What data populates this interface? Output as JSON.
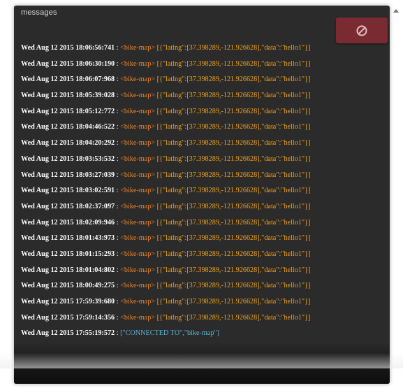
{
  "panel": {
    "title": "messages",
    "clear_button_icon": "block-icon"
  },
  "messages": [
    {
      "timestamp": "Wed Aug 12 2015 18:06:56:741",
      "separator": " : ",
      "channel": "<bike-map>",
      "payload": "[{\"latlng\":[37.398289,-121.926628],\"data\":\"hello1\"}]",
      "kind": "data"
    },
    {
      "timestamp": "Wed Aug 12 2015 18:06:30:190",
      "separator": " : ",
      "channel": "<bike-map>",
      "payload": "[{\"latlng\":[37.398289,-121.926628],\"data\":\"hello1\"}]",
      "kind": "data"
    },
    {
      "timestamp": "Wed Aug 12 2015 18:06:07:968",
      "separator": " : ",
      "channel": "<bike-map>",
      "payload": "[{\"latlng\":[37.398289,-121.926628],\"data\":\"hello1\"}]",
      "kind": "data"
    },
    {
      "timestamp": "Wed Aug 12 2015 18:05:39:028",
      "separator": " : ",
      "channel": "<bike-map>",
      "payload": "[{\"latlng\":[37.398289,-121.926628],\"data\":\"hello1\"}]",
      "kind": "data"
    },
    {
      "timestamp": "Wed Aug 12 2015 18:05:12:772",
      "separator": " : ",
      "channel": "<bike-map>",
      "payload": "[{\"latlng\":[37.398289,-121.926628],\"data\":\"hello1\"}]",
      "kind": "data"
    },
    {
      "timestamp": "Wed Aug 12 2015 18:04:46:522",
      "separator": " : ",
      "channel": "<bike-map>",
      "payload": "[{\"latlng\":[37.398289,-121.926628],\"data\":\"hello1\"}]",
      "kind": "data"
    },
    {
      "timestamp": "Wed Aug 12 2015 18:04:20:292",
      "separator": " : ",
      "channel": "<bike-map>",
      "payload": "[{\"latlng\":[37.398289,-121.926628],\"data\":\"hello1\"}]",
      "kind": "data"
    },
    {
      "timestamp": "Wed Aug 12 2015 18:03:53:532",
      "separator": " : ",
      "channel": "<bike-map>",
      "payload": "[{\"latlng\":[37.398289,-121.926628],\"data\":\"hello1\"}]",
      "kind": "data"
    },
    {
      "timestamp": "Wed Aug 12 2015 18:03:27:039",
      "separator": " : ",
      "channel": "<bike-map>",
      "payload": "[{\"latlng\":[37.398289,-121.926628],\"data\":\"hello1\"}]",
      "kind": "data"
    },
    {
      "timestamp": "Wed Aug 12 2015 18:03:02:591",
      "separator": " : ",
      "channel": "<bike-map>",
      "payload": "[{\"latlng\":[37.398289,-121.926628],\"data\":\"hello1\"}]",
      "kind": "data"
    },
    {
      "timestamp": "Wed Aug 12 2015 18:02:37:097",
      "separator": " : ",
      "channel": "<bike-map>",
      "payload": "[{\"latlng\":[37.398289,-121.926628],\"data\":\"hello1\"}]",
      "kind": "data"
    },
    {
      "timestamp": "Wed Aug 12 2015 18:02:09:946",
      "separator": " : ",
      "channel": "<bike-map>",
      "payload": "[{\"latlng\":[37.398289,-121.926628],\"data\":\"hello1\"}]",
      "kind": "data"
    },
    {
      "timestamp": "Wed Aug 12 2015 18:01:43:973",
      "separator": " : ",
      "channel": "<bike-map>",
      "payload": "[{\"latlng\":[37.398289,-121.926628],\"data\":\"hello1\"}]",
      "kind": "data"
    },
    {
      "timestamp": "Wed Aug 12 2015 18:01:15:293",
      "separator": " : ",
      "channel": "<bike-map>",
      "payload": "[{\"latlng\":[37.398289,-121.926628],\"data\":\"hello1\"}]",
      "kind": "data"
    },
    {
      "timestamp": "Wed Aug 12 2015 18:01:04:802",
      "separator": " : ",
      "channel": "<bike-map>",
      "payload": "[{\"latlng\":[37.398289,-121.926628],\"data\":\"hello1\"}]",
      "kind": "data"
    },
    {
      "timestamp": "Wed Aug 12 2015 18:00:49:275",
      "separator": " : ",
      "channel": "<bike-map>",
      "payload": "[{\"latlng\":[37.398289,-121.926628],\"data\":\"hello1\"}]",
      "kind": "data"
    },
    {
      "timestamp": "Wed Aug 12 2015 17:59:39:680",
      "separator": " : ",
      "channel": "<bike-map>",
      "payload": "[{\"latlng\":[37.398289,-121.926628],\"data\":\"hello1\"}]",
      "kind": "data"
    },
    {
      "timestamp": "Wed Aug 12 2015 17:59:14:356",
      "separator": " : ",
      "channel": "<bike-map>",
      "payload": "[{\"latlng\":[37.398289,-121.926628],\"data\":\"hello1\"}]",
      "kind": "data"
    },
    {
      "timestamp": "Wed Aug 12 2015 17:55:19:572",
      "separator": " : ",
      "channel": "",
      "payload": "[\"CONNECTED TO\",\"bike-map\"]",
      "kind": "info"
    }
  ],
  "colors": {
    "panel_bg": "#2b2b2b",
    "clear_button_bg": "#7a2a31",
    "timestamp": "#ffffff",
    "channel": "#e8822a",
    "payload": "#f0a020",
    "info_payload": "#5ab4d6"
  }
}
